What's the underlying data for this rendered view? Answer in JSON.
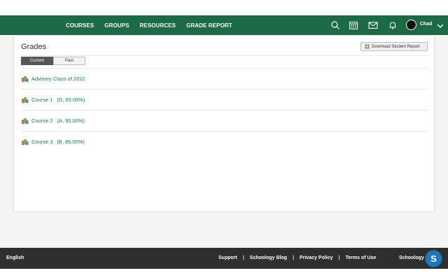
{
  "header": {
    "nav": [
      "COURSES",
      "GROUPS",
      "RESOURCES",
      "GRADE REPORT"
    ],
    "user_name": "Chad"
  },
  "page": {
    "title": "Grades",
    "download_label": "Download Student Report",
    "tabs": {
      "current": "Current",
      "past": "Past"
    }
  },
  "courses": [
    {
      "name": "Advisory Class of 2022",
      "grade": ""
    },
    {
      "name": "Course 1",
      "grade": "(D, 65.00%)"
    },
    {
      "name": "Course 2",
      "grade": "(A, 95.00%)"
    },
    {
      "name": "Course 3",
      "grade": "(B, 85.00%)"
    }
  ],
  "footer": {
    "language": "English",
    "links": [
      "Support",
      "Schoology Blog",
      "Privacy Policy",
      "Terms of Use"
    ],
    "brand": "Schoology ©",
    "fab_label": "S"
  },
  "colors": {
    "header": "#1b6a45",
    "link": "#1b7c55",
    "footer": "#2f2f2f",
    "fab": "#1f76ba"
  }
}
